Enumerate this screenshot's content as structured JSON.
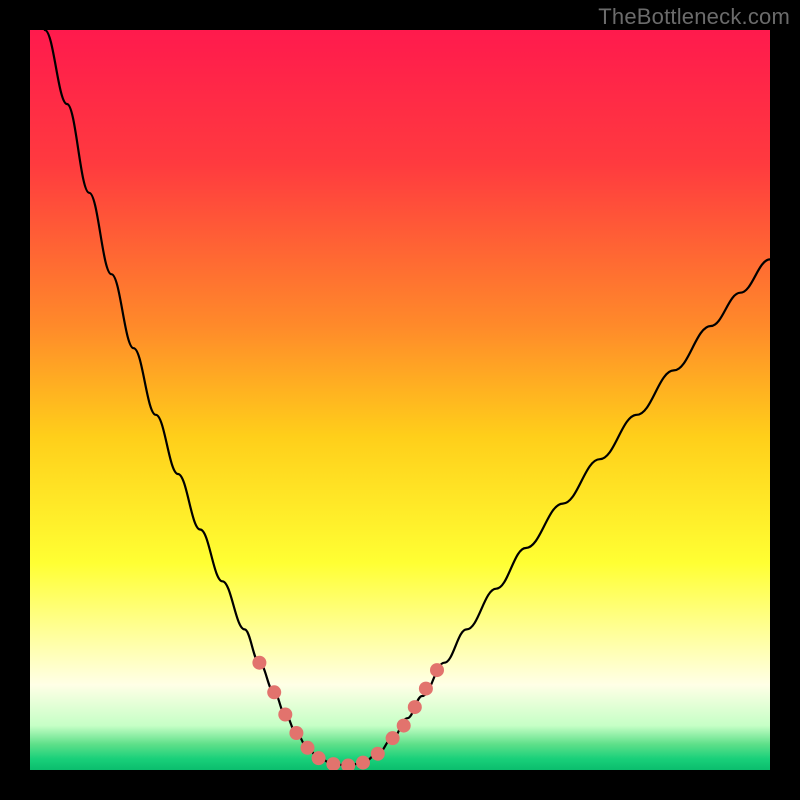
{
  "watermark": "TheBottleneck.com",
  "chart_data": {
    "type": "line",
    "title": "",
    "xlabel": "",
    "ylabel": "",
    "xlim": [
      0,
      100
    ],
    "ylim": [
      0,
      100
    ],
    "gradient_stops": [
      {
        "offset": 0,
        "color": "#ff1a4d"
      },
      {
        "offset": 0.18,
        "color": "#ff3a3f"
      },
      {
        "offset": 0.4,
        "color": "#ff8a2a"
      },
      {
        "offset": 0.55,
        "color": "#ffcf1a"
      },
      {
        "offset": 0.72,
        "color": "#ffff33"
      },
      {
        "offset": 0.83,
        "color": "#ffffaa"
      },
      {
        "offset": 0.885,
        "color": "#ffffe6"
      },
      {
        "offset": 0.94,
        "color": "#c6ffc6"
      },
      {
        "offset": 0.965,
        "color": "#5fe08a"
      },
      {
        "offset": 0.985,
        "color": "#19d07a"
      },
      {
        "offset": 1.0,
        "color": "#0bbd6d"
      }
    ],
    "series": [
      {
        "name": "bottleneck-curve",
        "color": "#000000",
        "width": 2.2,
        "points": [
          {
            "x": 2,
            "y": 100
          },
          {
            "x": 5,
            "y": 90
          },
          {
            "x": 8,
            "y": 78
          },
          {
            "x": 11,
            "y": 67
          },
          {
            "x": 14,
            "y": 57
          },
          {
            "x": 17,
            "y": 48
          },
          {
            "x": 20,
            "y": 40
          },
          {
            "x": 23,
            "y": 32.5
          },
          {
            "x": 26,
            "y": 25.5
          },
          {
            "x": 29,
            "y": 19
          },
          {
            "x": 31,
            "y": 14.5
          },
          {
            "x": 33,
            "y": 10.5
          },
          {
            "x": 34.5,
            "y": 7.5
          },
          {
            "x": 36,
            "y": 5
          },
          {
            "x": 37.5,
            "y": 3
          },
          {
            "x": 39,
            "y": 1.6
          },
          {
            "x": 41,
            "y": 0.8
          },
          {
            "x": 43,
            "y": 0.6
          },
          {
            "x": 45,
            "y": 1.0
          },
          {
            "x": 47,
            "y": 2.2
          },
          {
            "x": 49,
            "y": 4.3
          },
          {
            "x": 51,
            "y": 7
          },
          {
            "x": 53,
            "y": 10
          },
          {
            "x": 56,
            "y": 14.5
          },
          {
            "x": 59,
            "y": 19
          },
          {
            "x": 63,
            "y": 24.5
          },
          {
            "x": 67,
            "y": 30
          },
          {
            "x": 72,
            "y": 36
          },
          {
            "x": 77,
            "y": 42
          },
          {
            "x": 82,
            "y": 48
          },
          {
            "x": 87,
            "y": 54
          },
          {
            "x": 92,
            "y": 60
          },
          {
            "x": 96,
            "y": 64.5
          },
          {
            "x": 100,
            "y": 69
          }
        ]
      }
    ],
    "highlight_dots": {
      "color": "#e2736d",
      "radius": 7,
      "points": [
        {
          "x": 31,
          "y": 14.5
        },
        {
          "x": 33,
          "y": 10.5
        },
        {
          "x": 34.5,
          "y": 7.5
        },
        {
          "x": 36,
          "y": 5
        },
        {
          "x": 37.5,
          "y": 3
        },
        {
          "x": 39,
          "y": 1.6
        },
        {
          "x": 41,
          "y": 0.8
        },
        {
          "x": 43,
          "y": 0.6
        },
        {
          "x": 45,
          "y": 1.0
        },
        {
          "x": 47,
          "y": 2.2
        },
        {
          "x": 49,
          "y": 4.3
        },
        {
          "x": 50.5,
          "y": 6
        },
        {
          "x": 52,
          "y": 8.5
        },
        {
          "x": 53.5,
          "y": 11
        },
        {
          "x": 55,
          "y": 13.5
        }
      ]
    }
  }
}
